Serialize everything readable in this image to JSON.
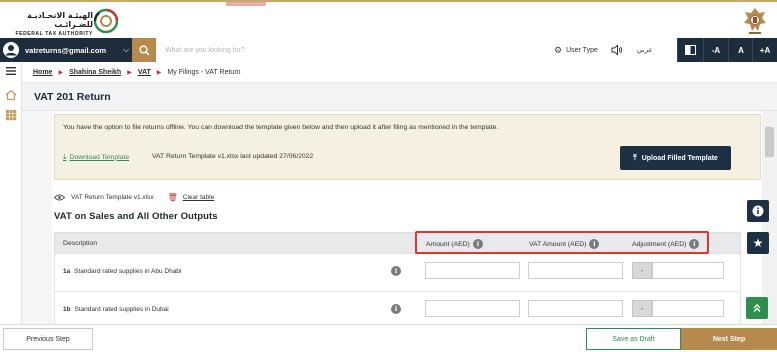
{
  "brand": {
    "name_ar": "الهيئـة الاتحـاديـة للضـرائـب",
    "name_en": "FEDERAL TAX AUTHORITY"
  },
  "nav": {
    "user_email": "vatreturns@gmail.com",
    "search_placeholder": "What are you looking for?",
    "user_type_label": "User Type",
    "language_label": "عربي",
    "font_decrease": "-A",
    "font_normal": "A",
    "font_increase": "+A"
  },
  "breadcrumb": {
    "home": "Home",
    "user": "Shahina Sheikh",
    "vat": "VAT",
    "current": "My Filings - VAT Return"
  },
  "page": {
    "title": "VAT 201 Return"
  },
  "notice": {
    "text": "You have the option to file returns offline. You can download the template given below and then upload it after filing as mentioned in the template.",
    "download_label": "Download Template",
    "template_info": "VAT Return Template v1.xlsx last updated 27/06/2022",
    "upload_label": "Upload Filled Template"
  },
  "file": {
    "name": "VAT Return Template v1.xlsx",
    "clear_label": "Clear table"
  },
  "section": {
    "title": "VAT on Sales and All Other Outputs"
  },
  "table": {
    "headers": {
      "description": "Description",
      "amount": "Amount (AED)",
      "vat_amount": "VAT Amount (AED)",
      "adjustment": "Adjustment (AED)"
    },
    "rows": [
      {
        "code": "1a",
        "label": "Standard rated supplies in Abu Dhabi",
        "amount": "",
        "vat_amount": "",
        "adjustment": ""
      },
      {
        "code": "1b",
        "label": "Standard rated supplies in Dubai",
        "amount": "",
        "vat_amount": "",
        "adjustment": ""
      }
    ],
    "minus_symbol": "-"
  },
  "footer": {
    "previous": "Previous Step",
    "save_draft": "Save as Draft",
    "next": "Next Step"
  },
  "colors": {
    "navy": "#1e2d3b",
    "gold": "#b68a4c",
    "green": "#2d8f4e",
    "highlight_red": "#e2342b"
  }
}
